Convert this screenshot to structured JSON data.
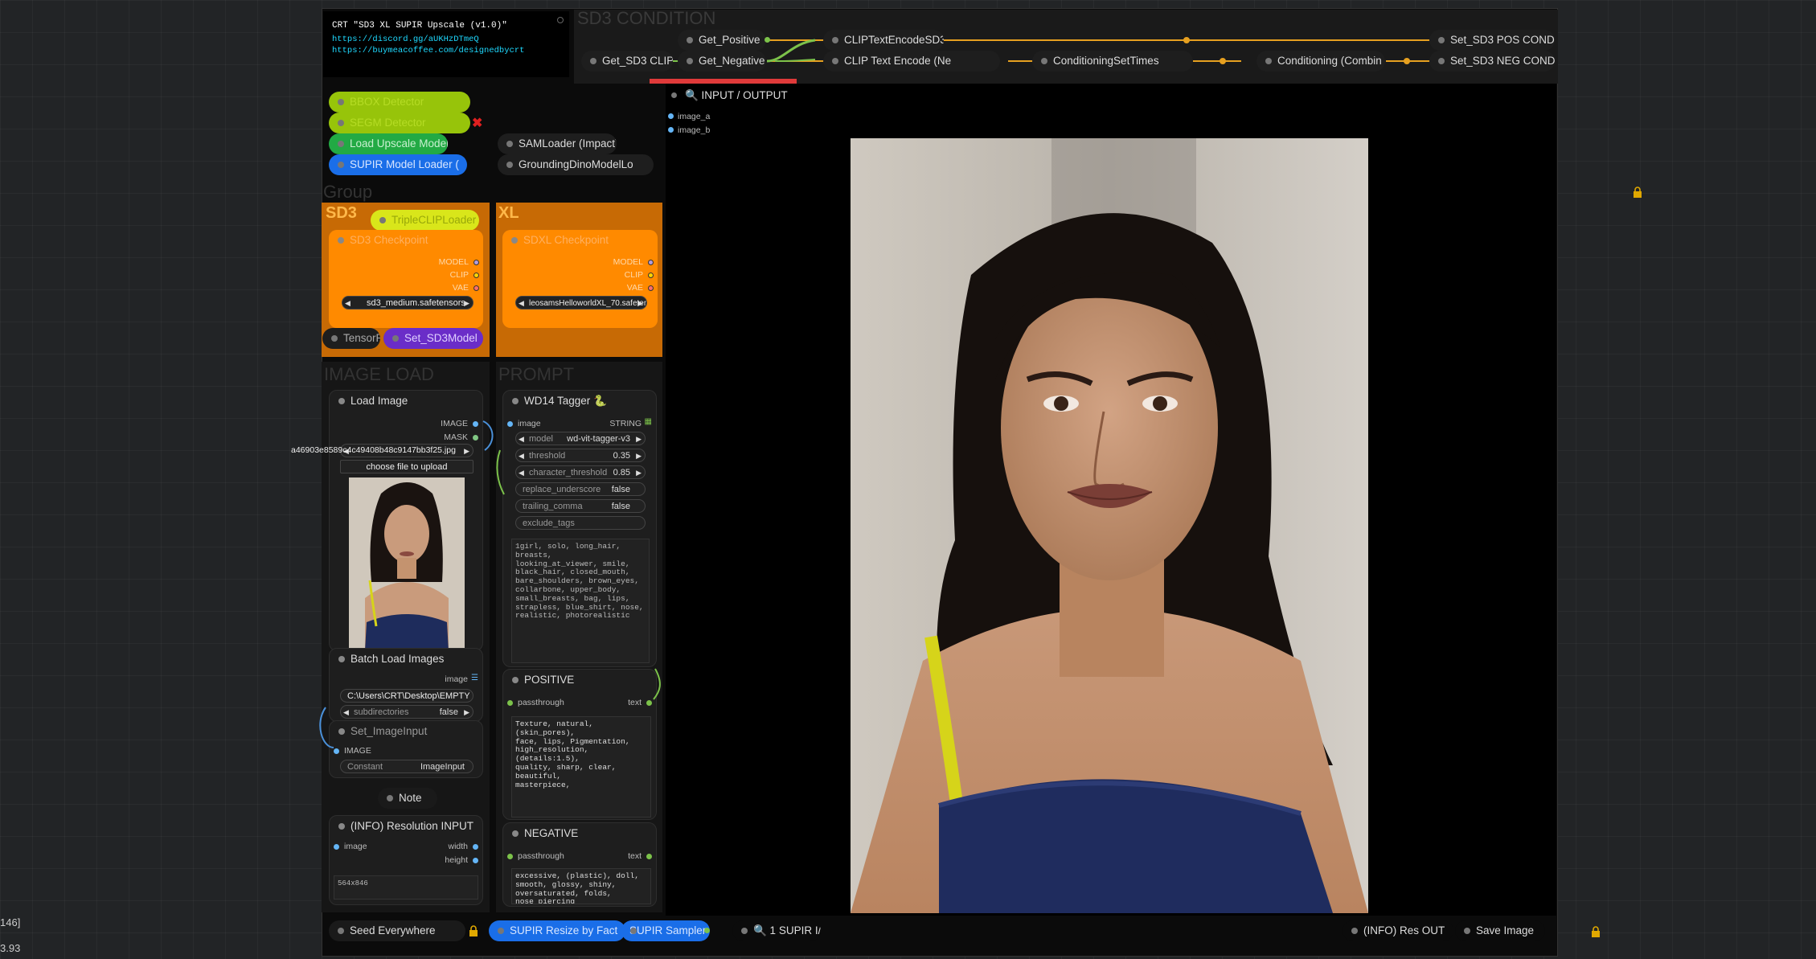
{
  "info": {
    "title": "CRT \"SD3 XL SUPIR Upscale (v1.0)\"",
    "link1": "https://discord.gg/aUKHzDTmeQ",
    "link2": "https://buymeacoffee.com/designedbycrt"
  },
  "groups": {
    "sd3_condition": "SD3 CONDITION",
    "group": "Group",
    "sd3": "SD3",
    "xl": "XL",
    "image_load": "IMAGE LOAD",
    "prompt": "PROMPT"
  },
  "condition_nodes": {
    "get_positive": "Get_Positive",
    "clip_text_encode_sd3": "CLIPTextEncodeSD3",
    "set_pos": "Set_SD3 POS COND",
    "get_sd3_clip": "Get_SD3 CLIP",
    "get_negative": "Get_Negative",
    "clip_text_encode_ne": "CLIP Text Encode (Ne",
    "conditioning_set_times": "ConditioningSetTimes",
    "conditioning_combine": "Conditioning (Combin",
    "set_neg": "Set_SD3 NEG COND"
  },
  "loaders": {
    "bbox_detector": "BBOX Detector",
    "segm_detector": "SEGM Detector",
    "load_upscale_model": "Load Upscale Model",
    "supir_loader": "SUPIR Model Loader (",
    "sam_loader": "SAMLoader (Impact)",
    "grounding_dino": "GroundingDinoModelLo"
  },
  "sd3_block": {
    "triple_clip": "TripleCLIPLoader",
    "checkpoint_title": "SD3 Checkpoint",
    "out_model": "MODEL",
    "out_clip": "CLIP",
    "out_vae": "VAE",
    "ckpt_value": "sd3_medium.safetensors",
    "tensorrt": "TensorRT",
    "set_sd3model": "Set_SD3Model"
  },
  "xl_block": {
    "checkpoint_title": "SDXL Checkpoint",
    "out_model": "MODEL",
    "out_clip": "CLIP",
    "out_vae": "VAE",
    "ckpt_value": "leosamsHelloworldXL_70.safetensors"
  },
  "load_image": {
    "title": "Load Image",
    "out_image": "IMAGE",
    "out_mask": "MASK",
    "filename": "a46903e8589c4c49408b48c9147bb3f25.jpg",
    "upload_label": "choose file to upload"
  },
  "batch_load": {
    "title": "Batch Load Images",
    "out_image": "image",
    "path": "C:\\Users\\CRT\\Desktop\\EMPTY",
    "subdir_label": "subdirectories",
    "subdir_value": "false"
  },
  "set_image_input": {
    "title": "Set_ImageInput",
    "in_image": "IMAGE",
    "constant_label": "Constant",
    "constant_value": "ImageInput"
  },
  "note": "Note",
  "resolution_input": {
    "title": "(INFO) Resolution INPUT",
    "in_image": "image",
    "out_width": "width",
    "out_height": "height",
    "value": "564x846"
  },
  "tagger": {
    "title": "WD14 Tagger",
    "in_image": "image",
    "out_string": "STRING",
    "model_label": "model",
    "model_value": "wd-vit-tagger-v3",
    "threshold_label": "threshold",
    "threshold_value": "0.35",
    "char_label": "character_threshold",
    "char_value": "0.85",
    "replace_label": "replace_underscore",
    "replace_value": "false",
    "trailing_label": "trailing_comma",
    "trailing_value": "false",
    "exclude_label": "exclude_tags",
    "tags": "1girl, solo, long_hair, breasts,\nlooking_at_viewer, smile,\nblack_hair, closed_mouth,\nbare_shoulders, brown_eyes,\ncollarbone, upper_body,\nsmall_breasts, bag, lips,\nstrapless, blue_shirt, nose,\nrealistic, photorealistic"
  },
  "positive": {
    "title": "POSITIVE",
    "in_label": "passthrough",
    "out_label": "text",
    "text": "Texture, natural, (skin_pores),\nface, lips, Pigmentation,\nhigh_resolution, (details:1.5),\nquality, sharp, clear, beautiful,\nmasterpiece,"
  },
  "negative": {
    "title": "NEGATIVE",
    "in_label": "passthrough",
    "out_label": "text",
    "text": "excessive, (plastic), doll,\nsmooth, glossy, shiny,\noversaturated, folds,\nnose_piercing"
  },
  "io_node": {
    "title": "🔍 INPUT / OUTPUT",
    "in_a": "image_a",
    "in_b": "image_b"
  },
  "bottom_bar": {
    "seed": "Seed Everywhere",
    "resize": "SUPIR Resize by Fact",
    "sampler": "SUPIR Sampler",
    "supir_io": "🔍 1 SUPIR I/",
    "res_out": "(INFO) Res OUT",
    "save": "Save Image"
  },
  "edge_text": {
    "a": "146]",
    "b": "3.93"
  },
  "colors": {
    "lime": "#97c40a",
    "green": "#22aa44",
    "blue": "#1a6ee8",
    "orange": "#ff8a00",
    "yellow": "#d9e61a",
    "purple": "#6a2dc8",
    "red_bar": "#e03a3a"
  }
}
